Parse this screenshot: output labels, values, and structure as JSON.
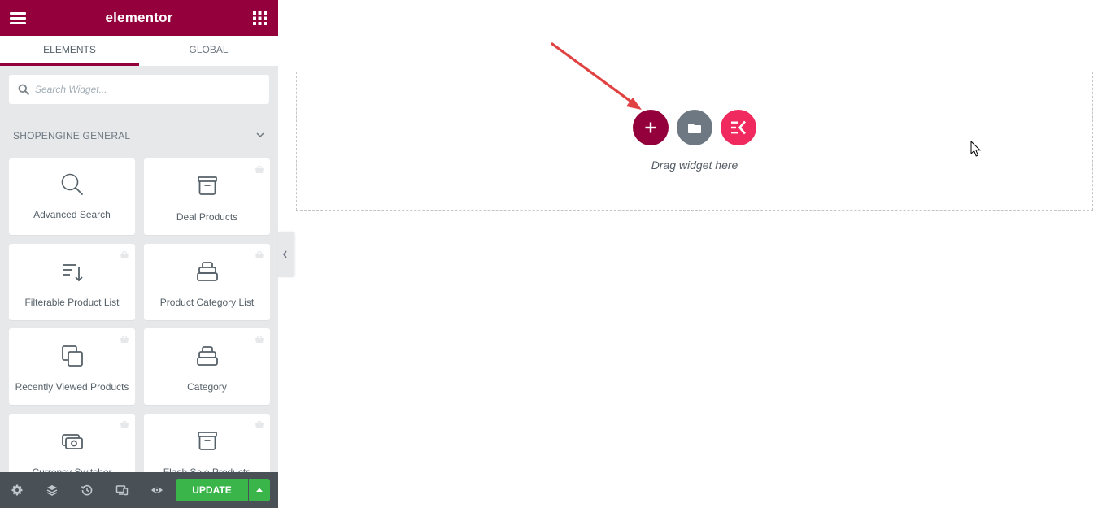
{
  "app": {
    "brand": "elementor"
  },
  "tabs": [
    {
      "label": "ELEMENTS",
      "active": true
    },
    {
      "label": "GLOBAL",
      "active": false
    }
  ],
  "search": {
    "placeholder": "Search Widget..."
  },
  "category": {
    "title": "SHOPENGINE GENERAL",
    "expanded": true
  },
  "widgets": [
    {
      "label": "Advanced Search",
      "icon": "magnifier-icon",
      "pro": false
    },
    {
      "label": "Deal Products",
      "icon": "archive-box-icon",
      "pro": true
    },
    {
      "label": "Filterable Product List",
      "icon": "sort-list-icon",
      "pro": true
    },
    {
      "label": "Product Category List",
      "icon": "stacked-box-icon",
      "pro": true
    },
    {
      "label": "Recently Viewed Products",
      "icon": "copy-squares-icon",
      "pro": true
    },
    {
      "label": "Category",
      "icon": "stacked-box-icon",
      "pro": true
    },
    {
      "label": "Currency Switcher",
      "icon": "currency-icon",
      "pro": true
    },
    {
      "label": "Flash Sale Products",
      "icon": "archive-box-icon",
      "pro": true
    }
  ],
  "footer": {
    "update_label": "UPDATE"
  },
  "canvas": {
    "drag_text": "Drag widget here"
  },
  "colors": {
    "brand": "#93003c",
    "update_green": "#39b54a",
    "template_gray": "#6d7882",
    "elementskit_pink": "#f0295f",
    "arrow_red": "#e04141"
  }
}
